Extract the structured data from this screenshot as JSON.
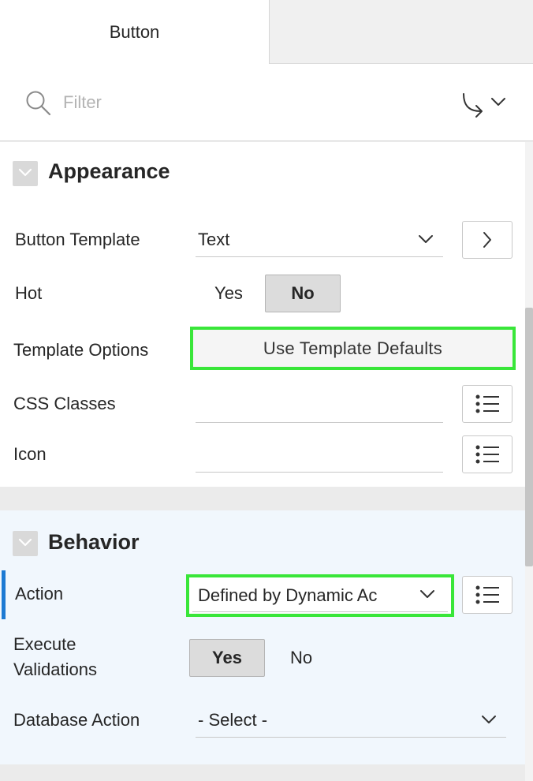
{
  "tabs": {
    "active_label": "Button"
  },
  "filter": {
    "placeholder": "Filter"
  },
  "appearance": {
    "title": "Appearance",
    "button_template": {
      "label": "Button Template",
      "value": "Text"
    },
    "hot": {
      "label": "Hot",
      "yes": "Yes",
      "no": "No",
      "selected": "No"
    },
    "template_options": {
      "label": "Template Options",
      "button": "Use Template Defaults"
    },
    "css_classes": {
      "label": "CSS Classes",
      "value": ""
    },
    "icon": {
      "label": "Icon",
      "value": ""
    }
  },
  "behavior": {
    "title": "Behavior",
    "action": {
      "label": "Action",
      "value": "Defined by Dynamic Ac"
    },
    "execute_validations": {
      "label_line1": "Execute",
      "label_line2": "Validations",
      "yes": "Yes",
      "no": "No",
      "selected": "Yes"
    },
    "database_action": {
      "label": "Database Action",
      "value": "- Select -"
    }
  },
  "colors": {
    "highlight": "#39e639",
    "accent": "#1d7ad3",
    "behavior_bg": "#f1f7fd"
  },
  "icons": [
    "search-icon",
    "go-to-group-icon",
    "chevron-down-icon",
    "chevron-right-icon",
    "list-icon"
  ]
}
